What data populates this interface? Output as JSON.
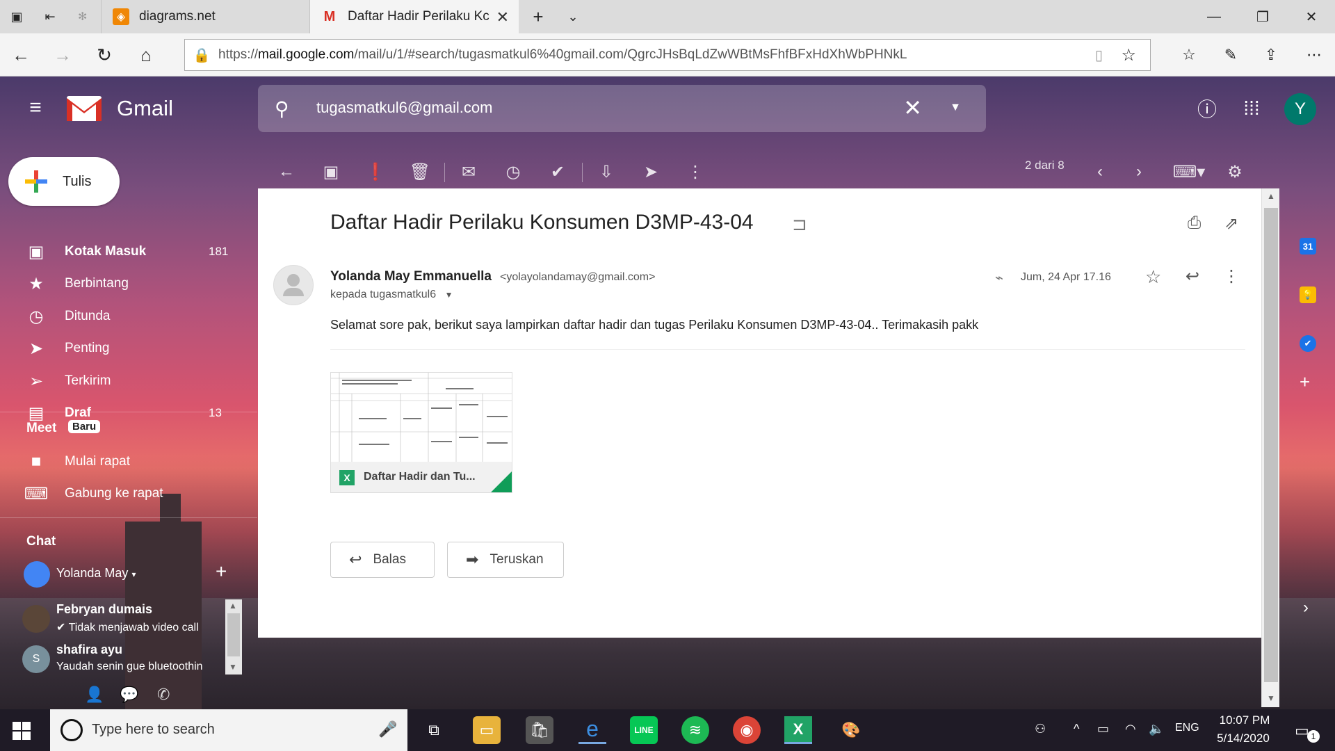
{
  "browser": {
    "tabs": [
      {
        "title": "diagrams.net",
        "active": false
      },
      {
        "title": "Daftar Hadir Perilaku Kc",
        "active": true
      }
    ],
    "url_prefix": "https://",
    "url_host": "mail.google.com",
    "url_path": "/mail/u/1/#search/tugasmatkul6%40gmail.com/QgrcJHsBqLdZwWBtMsFhfBFxHdXhWbPHNkL"
  },
  "gmail": {
    "app_name": "Gmail",
    "search_value": "tugasmatkul6@gmail.com",
    "avatar_letter": "Y",
    "compose_label": "Tulis",
    "nav": [
      {
        "label": "Kotak Masuk",
        "count": "181",
        "icon": "inbox-icon",
        "bold": true
      },
      {
        "label": "Berbintang",
        "count": "",
        "icon": "star-icon",
        "bold": false
      },
      {
        "label": "Ditunda",
        "count": "",
        "icon": "clock-icon",
        "bold": false
      },
      {
        "label": "Penting",
        "count": "",
        "icon": "important-icon",
        "bold": false
      },
      {
        "label": "Terkirim",
        "count": "",
        "icon": "send-icon",
        "bold": false
      },
      {
        "label": "Draf",
        "count": "13",
        "icon": "draft-icon",
        "bold": true
      }
    ],
    "meet": {
      "title": "Meet",
      "badge": "Baru",
      "items": [
        {
          "label": "Mulai rapat",
          "icon": "video-icon"
        },
        {
          "label": "Gabung ke rapat",
          "icon": "keyboard-icon"
        }
      ]
    },
    "chat": {
      "title": "Chat",
      "me": "Yolanda May",
      "contacts": [
        {
          "name": "Febryan dumais",
          "message": "Tidak menjawab video call"
        },
        {
          "name": "shafira ayu",
          "message": "Yaudah senin gue bluetoothin",
          "initial": "S"
        }
      ]
    },
    "pager": "2 dari 8",
    "message": {
      "subject": "Daftar Hadir Perilaku Konsumen D3MP-43-04",
      "sender_name": "Yolanda May Emmanuella",
      "sender_email": "<yolayolandamay@gmail.com>",
      "recipient": "kepada tugasmatkul6",
      "date": "Jum, 24 Apr 17.16",
      "body": "Selamat sore pak, berikut saya lampirkan daftar hadir dan tugas Perilaku Konsumen D3MP-43-04.. Terimakasih pakk",
      "attachment_name": "Daftar Hadir dan Tu...",
      "reply_label": "Balas",
      "forward_label": "Teruskan"
    }
  },
  "taskbar": {
    "search_placeholder": "Type here to search",
    "language": "ENG",
    "time": "10:07 PM",
    "date": "5/14/2020",
    "notification_count": "1"
  }
}
